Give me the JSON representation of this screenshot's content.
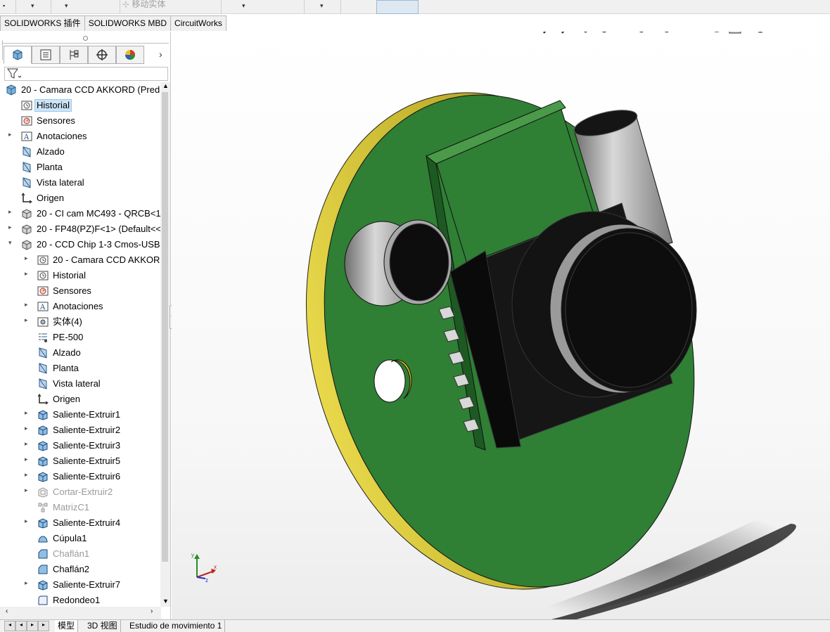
{
  "topbar": {
    "move_solid_label": "移动实体"
  },
  "cmd_tabs": [
    "SOLIDWORKS 插件",
    "SOLIDWORKS MBD",
    "CircuitWorks"
  ],
  "tree": {
    "root": "20 - Camara CCD AKKORD  (Pred",
    "items": [
      {
        "label": "Historial"
      },
      {
        "label": "Sensores"
      },
      {
        "label": "Anotaciones"
      },
      {
        "label": "Alzado"
      },
      {
        "label": "Planta"
      },
      {
        "label": "Vista lateral"
      },
      {
        "label": "Origen"
      },
      {
        "label": "20 - CI cam MC493 - QRCB<1"
      },
      {
        "label": "20 - FP48(PZ)F<1> (Default<<"
      },
      {
        "label": "20 - CCD Chip 1-3 Cmos-USB"
      },
      {
        "label": "20 - Camara CCD AKKORD"
      },
      {
        "label": "Historial"
      },
      {
        "label": "Sensores"
      },
      {
        "label": "Anotaciones"
      },
      {
        "label": "实体(4)"
      },
      {
        "label": "PE-500"
      },
      {
        "label": "Alzado"
      },
      {
        "label": "Planta"
      },
      {
        "label": "Vista lateral"
      },
      {
        "label": "Origen"
      },
      {
        "label": "Saliente-Extruir1"
      },
      {
        "label": "Saliente-Extruir2"
      },
      {
        "label": "Saliente-Extruir3"
      },
      {
        "label": "Saliente-Extruir5"
      },
      {
        "label": "Saliente-Extruir6"
      },
      {
        "label": "Cortar-Extruir2"
      },
      {
        "label": "MatrizC1"
      },
      {
        "label": "Saliente-Extruir4"
      },
      {
        "label": "Cúpula1"
      },
      {
        "label": "Chaflán1"
      },
      {
        "label": "Chaflán2"
      },
      {
        "label": "Saliente-Extruir7"
      },
      {
        "label": "Redondeo1"
      }
    ]
  },
  "bottom_tabs": [
    "模型",
    "3D 视图",
    "Estudio de movimiento 1"
  ],
  "colors": {
    "board": "#2f7f35",
    "board_edge": "#c8b41a",
    "part": "#111111",
    "selection": "#cce4f7"
  },
  "triad": {
    "x": "x",
    "y": "y",
    "z": "z"
  }
}
